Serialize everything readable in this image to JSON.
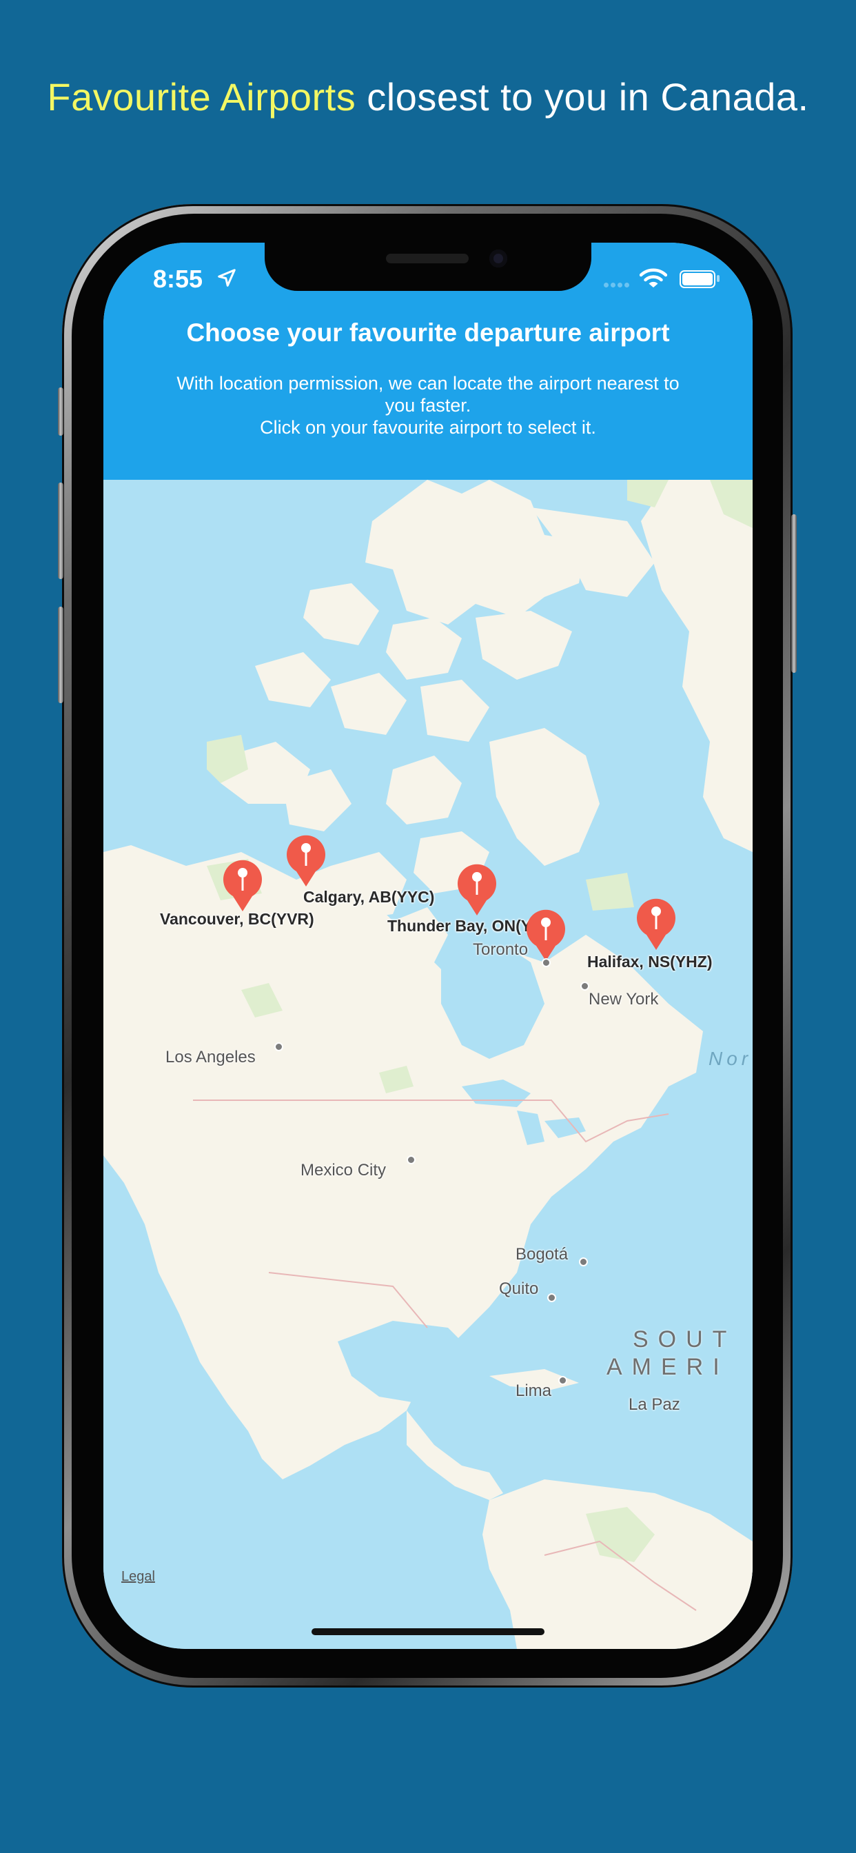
{
  "promo": {
    "headline_highlight": "Favourite Airports",
    "headline_rest": " closest to you in Canada.",
    "highlight_color": "#f3f763",
    "background_color": "#116796"
  },
  "status_bar": {
    "time": "8:55",
    "icons": [
      "location-arrow-icon",
      "signal-icon",
      "wifi-icon",
      "battery-icon"
    ]
  },
  "header": {
    "title": "Choose your favourite departure airport",
    "description_lines": [
      "With location permission, we can locate the airport nearest to",
      "you faster.",
      "Click on your favourite airport to select it."
    ],
    "color": "#1ea3ea"
  },
  "map": {
    "airports": [
      {
        "label": "Vancouver, BC(YVR)"
      },
      {
        "label": "Calgary, AB(YYC)"
      },
      {
        "label": "Thunder Bay, ON(YQT)"
      },
      {
        "label": "Toronto"
      },
      {
        "label": "Halifax, NS(YHZ)"
      }
    ],
    "cities": [
      "Toronto",
      "New York",
      "Los Angeles",
      "Mexico City",
      "Bogotá",
      "Quito",
      "Lima",
      "La Paz"
    ],
    "regions": [
      "SOUT",
      "AMERI"
    ],
    "ocean_label": "Nor",
    "legal": "Legal",
    "pin_color": "#f05a4a"
  }
}
